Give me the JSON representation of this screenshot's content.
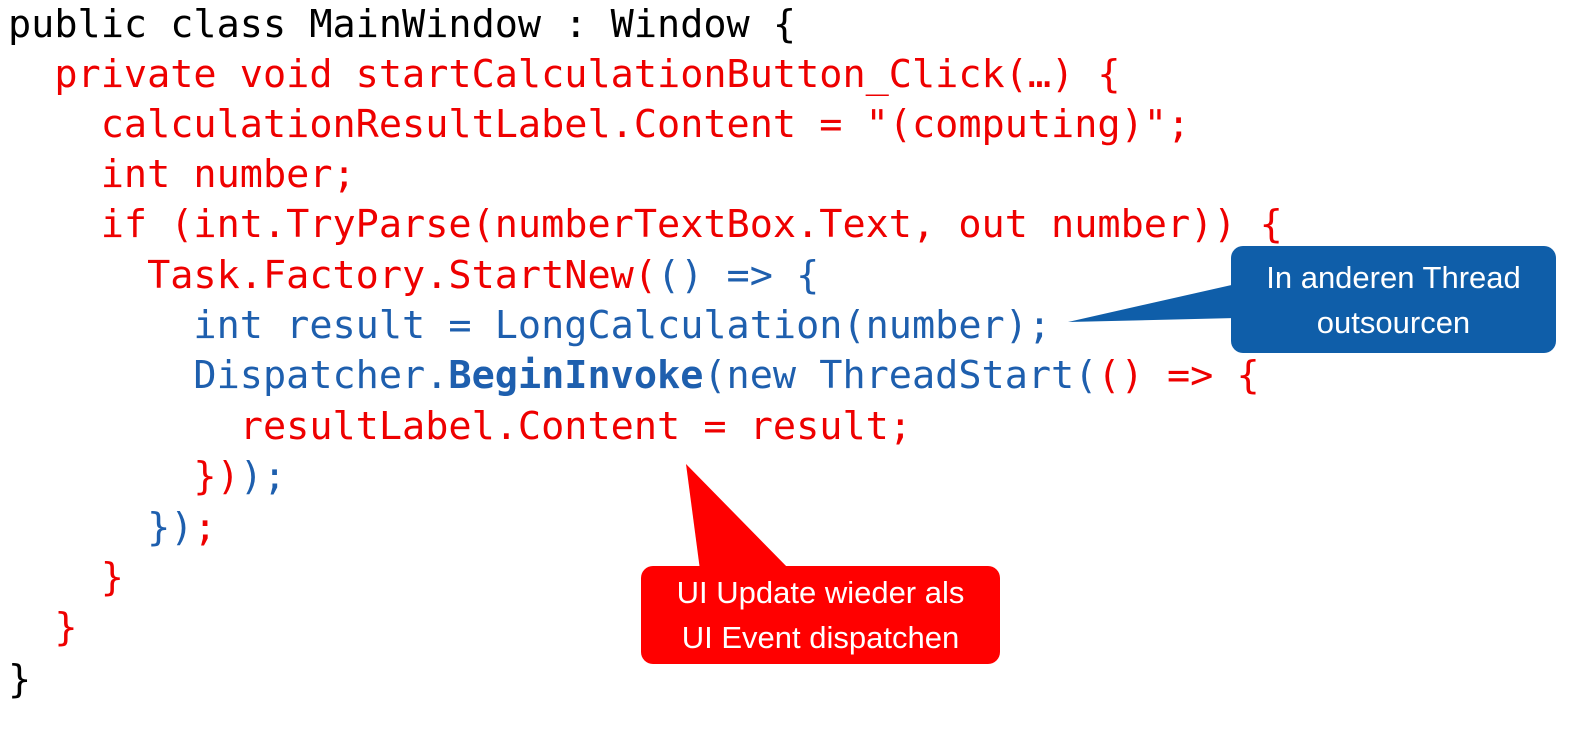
{
  "colors": {
    "black": "#000000",
    "red": "#ee0000",
    "blue": "#1e5fae",
    "callout_blue": "#0f5ea9",
    "callout_red": "#ff0000",
    "white": "#ffffff"
  },
  "code": {
    "lines": [
      [
        {
          "text": "public class MainWindow : Window {",
          "color": "black"
        }
      ],
      [
        {
          "text": "  private void startCalculationButton_Click(…) {",
          "color": "red"
        }
      ],
      [
        {
          "text": "    calculationResultLabel.Content = \"(computing)\";",
          "color": "red"
        }
      ],
      [
        {
          "text": "    int number;",
          "color": "red"
        }
      ],
      [
        {
          "text": "    if (int.TryParse(numberTextBox.Text, out number)) {",
          "color": "red"
        }
      ],
      [
        {
          "text": "      Task.Factory.StartNew(",
          "color": "red"
        },
        {
          "text": "() => {",
          "color": "blue"
        }
      ],
      [
        {
          "text": "        int result = LongCalculation(number);",
          "color": "blue"
        }
      ],
      [
        {
          "text": "        Dispatcher.",
          "color": "blue"
        },
        {
          "text": "BeginInvoke",
          "color": "blue",
          "bold": true
        },
        {
          "text": "(new ThreadStart(",
          "color": "blue"
        },
        {
          "text": "() => {",
          "color": "red"
        }
      ],
      [
        {
          "text": "          resultLabel.Content = result;",
          "color": "red"
        }
      ],
      [
        {
          "text": "        })",
          "color": "red"
        },
        {
          "text": ");",
          "color": "blue"
        }
      ],
      [
        {
          "text": "      })",
          "color": "blue"
        },
        {
          "text": ";",
          "color": "red"
        }
      ],
      [
        {
          "text": "    }",
          "color": "red"
        }
      ],
      [
        {
          "text": "  }",
          "color": "red"
        }
      ],
      [
        {
          "text": "}",
          "color": "black"
        }
      ]
    ]
  },
  "callouts": {
    "thread": {
      "line1": "In anderen Thread",
      "line2": "outsourcen"
    },
    "ui": {
      "line1": "UI Update wieder als",
      "line2": "UI Event dispatchen"
    }
  }
}
